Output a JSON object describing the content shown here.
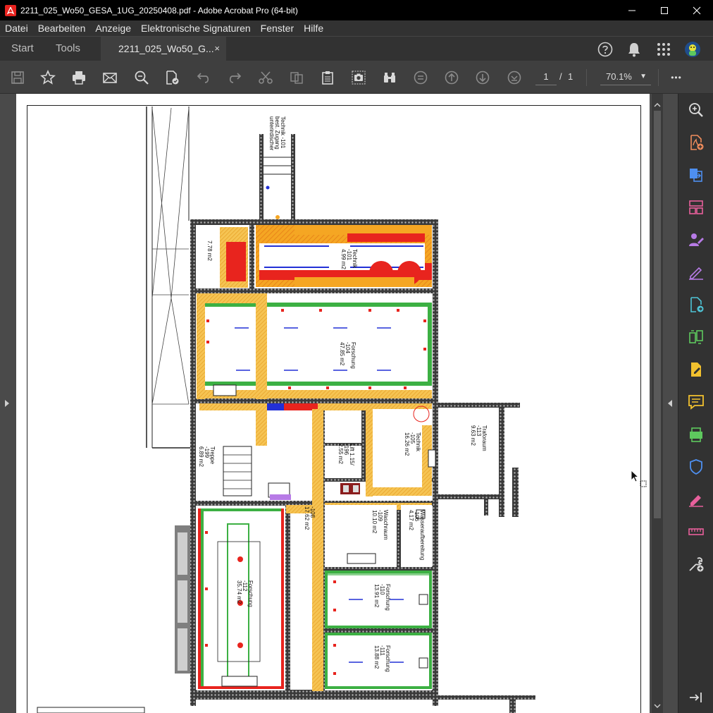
{
  "window": {
    "title": "2211_025_Wo50_GESA_1UG_20250408.pdf - Adobe Acrobat Pro (64-bit)",
    "app_icon": "acrobat-icon"
  },
  "menu": [
    "Datei",
    "Bearbeiten",
    "Anzeige",
    "Elektronische Signaturen",
    "Fenster",
    "Hilfe"
  ],
  "tabs": {
    "start": "Start",
    "tools": "Tools",
    "document": "2211_025_Wo50_G...",
    "close_glyph": "×"
  },
  "toolbar": {
    "current_page": "1",
    "page_separator": "/",
    "total_pages": "1",
    "zoom": "70.1%",
    "more": "•••"
  },
  "floorplan": {
    "rooms": [
      {
        "name": "Technik",
        "num": "-101",
        "area": "4.99 m2"
      },
      {
        "name": "Forschung",
        "num": "-104",
        "area": "47.85 m2"
      },
      {
        "name": "Technik",
        "num": "-105",
        "area": "16.26 m2"
      },
      {
        "name": "Trafo­raum",
        "num": "-113",
        "area": "9.63 m2"
      },
      {
        "name": "Treppe",
        "num": "-199",
        "area": "6.89 m2"
      },
      {
        "name": "Waschraum",
        "num": "-109",
        "area": "10.10 m2"
      },
      {
        "name": "Forschung",
        "num": "-110",
        "area": "13.91 m2"
      },
      {
        "name": "Forschung",
        "num": "-111",
        "area": "13.88 m2"
      },
      {
        "name": "Forschung",
        "num": "-112",
        "area": "35.74 m2"
      }
    ],
    "labels": {
      "top_note_1": "unterirdischer",
      "top_note_2": "best. Zugang",
      "top_note_3": "Technik -101",
      "small_room": "7.78 m2",
      "corridor_num": "-108",
      "corridor_area": "17.62 m2",
      "wc_num": "-106",
      "wc_area": "4.17 m2",
      "wc_name": "Wasseraufbereitung",
      "lift": "Lift 1.15/",
      "lift_num": "-196",
      "lift_area": "2.55 m2"
    }
  },
  "colors": {
    "accent_yellow": "#f6c453",
    "hazard_orange": "#f5a623",
    "red_zone": "#e8241e",
    "green_zone": "#3cb043",
    "blue_zone": "#2230d6",
    "acrobat_red": "#e8231f",
    "pane_purple": "#b77be6",
    "pane_green": "#5ec85e",
    "pane_orange": "#f08c5c",
    "pane_pink": "#e8609c",
    "pane_yellow": "#f2c12e",
    "pane_blue": "#4e8ff0"
  }
}
